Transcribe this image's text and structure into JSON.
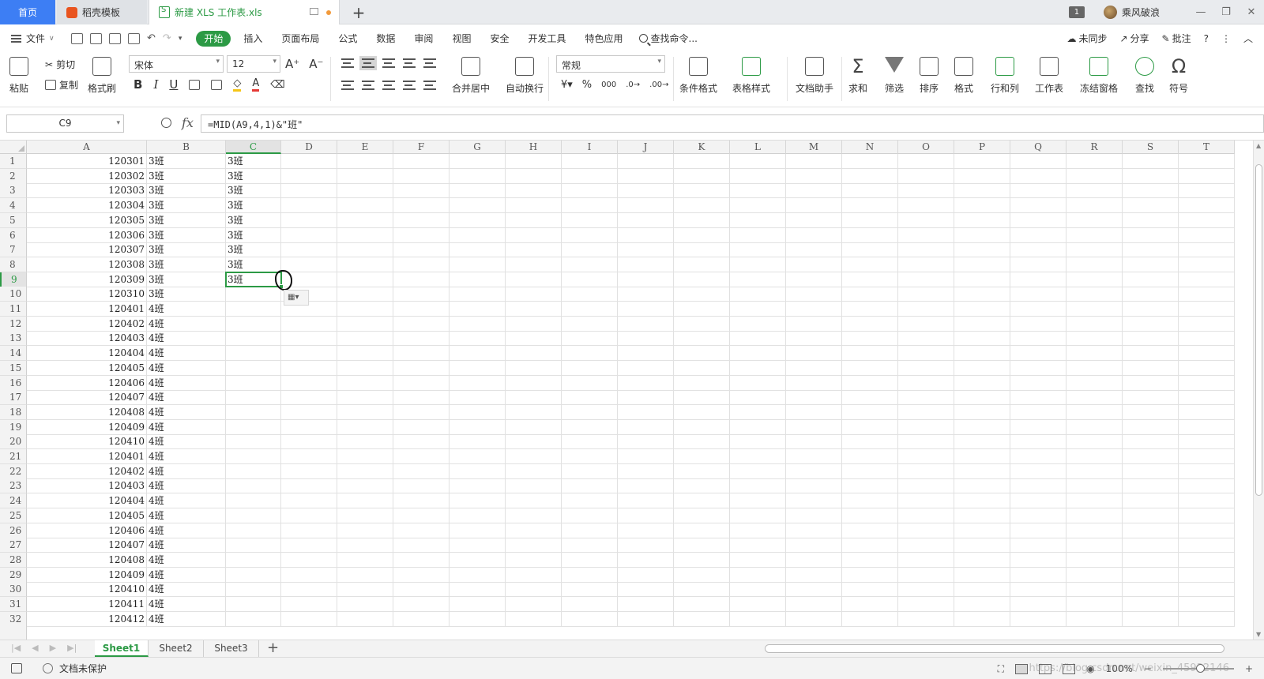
{
  "window": {
    "tabs": [
      {
        "label": "首页"
      },
      {
        "label": "稻壳模板"
      },
      {
        "label": "新建 XLS 工作表.xls"
      }
    ],
    "window_count": "1",
    "user_name": "乘风破浪",
    "controls": {
      "minimize": "—",
      "restore": "❐",
      "close": "✕"
    }
  },
  "menubar": {
    "file_label": "文件",
    "items": [
      "开始",
      "插入",
      "页面布局",
      "公式",
      "数据",
      "审阅",
      "视图",
      "安全",
      "开发工具",
      "特色应用"
    ],
    "active": "开始",
    "search_label": "查找命令...",
    "right": {
      "sync": "未同步",
      "share": "分享",
      "comment": "批注",
      "help": "?",
      "more": "⋮",
      "collapse": "︿"
    }
  },
  "ribbon": {
    "paste": "粘贴",
    "cut": "剪切",
    "copy": "复制",
    "format_painter": "格式刷",
    "font_name": "宋体",
    "font_size": "12",
    "bold": "B",
    "italic": "I",
    "underline": "U",
    "merge_center": "合并居中",
    "wrap_text": "自动换行",
    "number_format": "常规",
    "percent": "%",
    "thousands": "000",
    "conditional_format": "条件格式",
    "table_style": "表格样式",
    "doc_assistant": "文档助手",
    "sum": "求和",
    "filter": "筛选",
    "sort": "排序",
    "format": "格式",
    "row_col": "行和列",
    "worksheet": "工作表",
    "freeze": "冻结窗格",
    "find": "查找",
    "symbol": "符号"
  },
  "formula_bar": {
    "name_box": "C9",
    "fx": "fx",
    "formula": "=MID(A9,4,1)&\"班\""
  },
  "sheet": {
    "columns": [
      "A",
      "B",
      "C",
      "D",
      "E",
      "F",
      "G",
      "H",
      "I",
      "J",
      "K",
      "L",
      "M",
      "N",
      "O",
      "P",
      "Q",
      "R",
      "S",
      "T"
    ],
    "active_column": "C",
    "active_row": 9,
    "rows": [
      {
        "row": "1",
        "A": "120301",
        "B": "3班",
        "C": "3班"
      },
      {
        "row": "2",
        "A": "120302",
        "B": "3班",
        "C": "3班"
      },
      {
        "row": "3",
        "A": "120303",
        "B": "3班",
        "C": "3班"
      },
      {
        "row": "4",
        "A": "120304",
        "B": "3班",
        "C": "3班"
      },
      {
        "row": "5",
        "A": "120305",
        "B": "3班",
        "C": "3班"
      },
      {
        "row": "6",
        "A": "120306",
        "B": "3班",
        "C": "3班"
      },
      {
        "row": "7",
        "A": "120307",
        "B": "3班",
        "C": "3班"
      },
      {
        "row": "8",
        "A": "120308",
        "B": "3班",
        "C": "3班"
      },
      {
        "row": "9",
        "A": "120309",
        "B": "3班",
        "C": "3班"
      },
      {
        "row": "10",
        "A": "120310",
        "B": "3班",
        "C": ""
      },
      {
        "row": "11",
        "A": "120401",
        "B": "4班",
        "C": ""
      },
      {
        "row": "12",
        "A": "120402",
        "B": "4班",
        "C": ""
      },
      {
        "row": "13",
        "A": "120403",
        "B": "4班",
        "C": ""
      },
      {
        "row": "14",
        "A": "120404",
        "B": "4班",
        "C": ""
      },
      {
        "row": "15",
        "A": "120405",
        "B": "4班",
        "C": ""
      },
      {
        "row": "16",
        "A": "120406",
        "B": "4班",
        "C": ""
      },
      {
        "row": "17",
        "A": "120407",
        "B": "4班",
        "C": ""
      },
      {
        "row": "18",
        "A": "120408",
        "B": "4班",
        "C": ""
      },
      {
        "row": "19",
        "A": "120409",
        "B": "4班",
        "C": ""
      },
      {
        "row": "20",
        "A": "120410",
        "B": "4班",
        "C": ""
      },
      {
        "row": "21",
        "A": "120401",
        "B": "4班",
        "C": ""
      },
      {
        "row": "22",
        "A": "120402",
        "B": "4班",
        "C": ""
      },
      {
        "row": "23",
        "A": "120403",
        "B": "4班",
        "C": ""
      },
      {
        "row": "24",
        "A": "120404",
        "B": "4班",
        "C": ""
      },
      {
        "row": "25",
        "A": "120405",
        "B": "4班",
        "C": ""
      },
      {
        "row": "26",
        "A": "120406",
        "B": "4班",
        "C": ""
      },
      {
        "row": "27",
        "A": "120407",
        "B": "4班",
        "C": ""
      },
      {
        "row": "28",
        "A": "120408",
        "B": "4班",
        "C": ""
      },
      {
        "row": "29",
        "A": "120409",
        "B": "4班",
        "C": ""
      },
      {
        "row": "30",
        "A": "120410",
        "B": "4班",
        "C": ""
      },
      {
        "row": "31",
        "A": "120411",
        "B": "4班",
        "C": ""
      },
      {
        "row": "32",
        "A": "120412",
        "B": "4班",
        "C": ""
      }
    ]
  },
  "sheet_tabs": [
    {
      "label": "Sheet1",
      "active": true
    },
    {
      "label": "Sheet2",
      "active": false
    },
    {
      "label": "Sheet3",
      "active": false
    }
  ],
  "statusbar": {
    "protect": "文档未保护",
    "zoom": "100%",
    "watermark": "https://blog.csdn.net/weixin_45932146"
  },
  "colors": {
    "accent_green": "#2c9a45",
    "home_tab_blue": "#3d7ef4",
    "doc_dot": "#f29a3b"
  }
}
